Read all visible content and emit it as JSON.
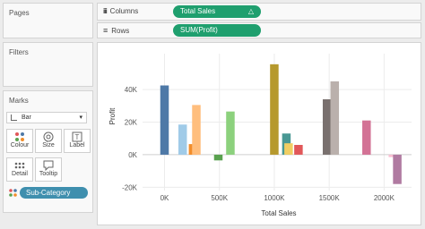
{
  "left_panel": {
    "pages_title": "Pages",
    "filters_title": "Filters",
    "marks_title": "Marks",
    "mark_type": "Bar",
    "buttons": [
      {
        "label": "Colour",
        "icon": "colour-icon"
      },
      {
        "label": "Size",
        "icon": "size-icon"
      },
      {
        "label": "Label",
        "icon": "label-icon"
      },
      {
        "label": "Detail",
        "icon": "detail-icon"
      },
      {
        "label": "Tooltip",
        "icon": "tooltip-icon"
      }
    ],
    "color_field": "Sub-Category"
  },
  "shelves": {
    "columns_label": "Columns",
    "columns_pill": "Total Sales",
    "columns_pill_mark": "△",
    "rows_label": "Rows",
    "rows_pill": "SUM(Profit)"
  },
  "colors": {
    "pill_green": "#1f9f6e",
    "color_pill": "#3f8fae"
  },
  "chart_data": {
    "type": "bar",
    "xlabel": "Total Sales",
    "ylabel": "Profit",
    "xlim": [
      -200000,
      2250000
    ],
    "ylim": [
      -22000,
      62000
    ],
    "x_ticks": [
      0,
      500000,
      1000000,
      1500000,
      2000000
    ],
    "x_tick_labels": [
      "0K",
      "500K",
      "1000K",
      "1500K",
      "2000K"
    ],
    "y_ticks": [
      -20000,
      0,
      20000,
      40000
    ],
    "y_tick_labels": [
      "-20K",
      "0K",
      "20K",
      "40K"
    ],
    "grid": true,
    "bars": [
      {
        "x": 0,
        "value": 42500,
        "color": "#4e79a7"
      },
      {
        "x": 165000,
        "value": 18500,
        "color": "#a0cbe8"
      },
      {
        "x": 260000,
        "value": 6500,
        "color": "#f28e2b"
      },
      {
        "x": 290000,
        "value": 30500,
        "color": "#ffbe7d"
      },
      {
        "x": 490000,
        "value": -3500,
        "color": "#59a14f"
      },
      {
        "x": 600000,
        "value": 26500,
        "color": "#8cd17d"
      },
      {
        "x": 1000000,
        "value": 55500,
        "color": "#b6992d"
      },
      {
        "x": 1110000,
        "value": 13000,
        "color": "#499894"
      },
      {
        "x": 1130000,
        "value": 7000,
        "color": "#f1ce63"
      },
      {
        "x": 1220000,
        "value": 6000,
        "color": "#e15759"
      },
      {
        "x": 1480000,
        "value": 34000,
        "color": "#79706e"
      },
      {
        "x": 1550000,
        "value": 45000,
        "color": "#bab0ac"
      },
      {
        "x": 1840000,
        "value": 21000,
        "color": "#d37295"
      },
      {
        "x": 2080000,
        "value": -1500,
        "color": "#fabfd2"
      },
      {
        "x": 2120000,
        "value": -18000,
        "color": "#b07aa1"
      }
    ]
  }
}
